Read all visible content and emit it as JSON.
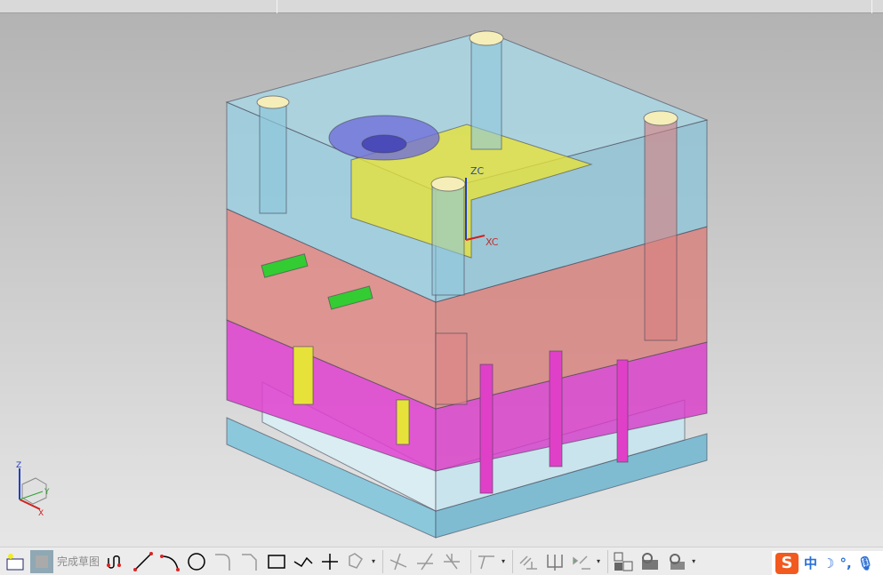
{
  "toolbar": {
    "finish_sketch_label": "完成草图",
    "items": [
      "finish-sketch",
      "profile",
      "line",
      "arc",
      "circle",
      "fillet",
      "chamfer",
      "rectangle",
      "polygon-studio",
      "point",
      "offset",
      "quick-trim",
      "quick-extend",
      "make-corner",
      "dimension",
      "parallel",
      "perpendicular",
      "constraint",
      "show-constraints",
      "convert-to-reference",
      "animate"
    ]
  },
  "viewport": {
    "wcs": {
      "z_label": "ZC",
      "x_label": "XC"
    },
    "triad": {
      "z": "Z",
      "y": "Y",
      "x": "X"
    }
  },
  "ime": {
    "logo": "S",
    "mode": "中",
    "punct": "°,"
  },
  "colors": {
    "top_plate": "#8fc8dc",
    "a_plate": "#e08a86",
    "b_plate": "#e040d0",
    "ejector": "#c8e4ec",
    "bottom_plate": "#8cc8dc",
    "insert": "#e6e23a"
  }
}
